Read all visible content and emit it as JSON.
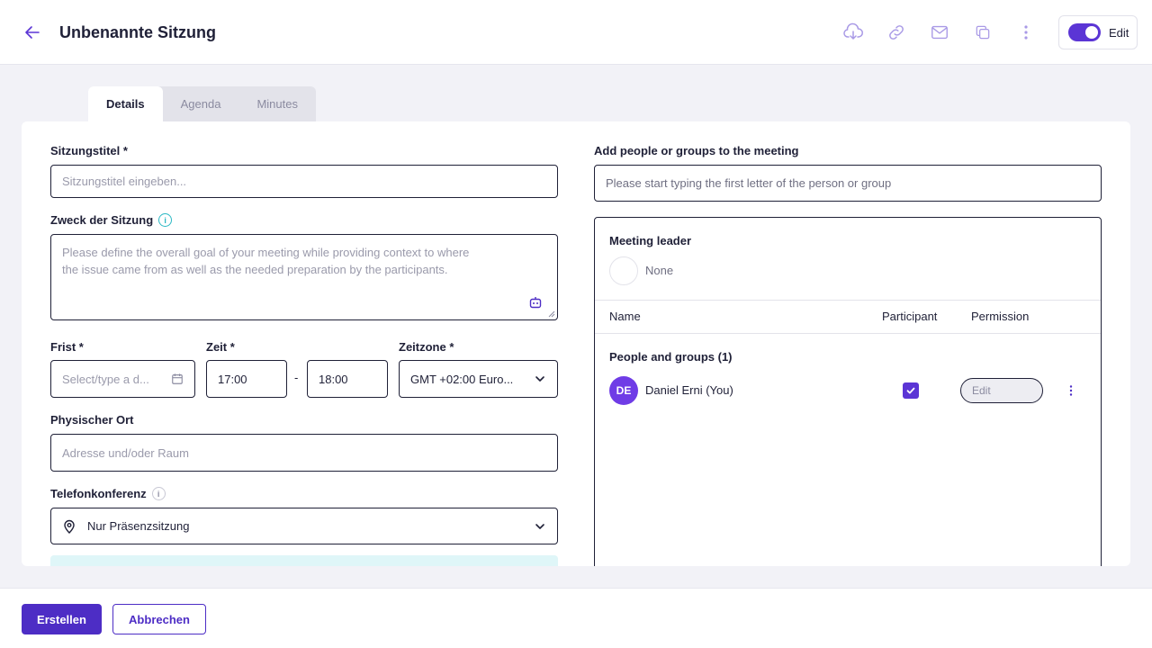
{
  "header": {
    "title": "Unbenannte Sitzung",
    "edit_label": "Edit",
    "edit_mode": true,
    "icons": [
      "arrow-left-icon",
      "cloud-download-icon",
      "link-icon",
      "mail-icon",
      "copy-icon",
      "more-vertical-icon"
    ]
  },
  "tabs": [
    {
      "label": "Details",
      "active": true
    },
    {
      "label": "Agenda",
      "active": false
    },
    {
      "label": "Minutes",
      "active": false
    }
  ],
  "form": {
    "title_label": "Sitzungstitel *",
    "title_placeholder": "Sitzungstitel eingeben...",
    "purpose_label": "Zweck der Sitzung",
    "purpose_placeholder_line1": "Please define the overall goal of your meeting while providing context to where",
    "purpose_placeholder_line2": "the issue came from as well as the needed preparation by the participants.",
    "deadline_label": "Frist *",
    "deadline_placeholder": "Select/type a d...",
    "time_label": "Zeit *",
    "time_start": "17:00",
    "time_separator": "-",
    "time_end": "18:00",
    "timezone_label": "Zeitzone *",
    "timezone_value": "GMT +02:00 Euro...",
    "location_label": "Physischer Ort",
    "location_placeholder": "Adresse und/oder Raum",
    "conference_label": "Telefonkonferenz",
    "conference_value": "Nur Präsenzsitzung"
  },
  "people": {
    "add_label": "Add people or groups to the meeting",
    "search_placeholder": "Please start typing the first letter of the person or group",
    "leader_label": "Meeting leader",
    "leader_value": "None",
    "col_name": "Name",
    "col_participant": "Participant",
    "col_permission": "Permission",
    "group_heading": "People and groups (1)",
    "members": [
      {
        "initials": "DE",
        "name": "Daniel Erni (You)",
        "participant": true,
        "permission": "Edit"
      }
    ]
  },
  "footer": {
    "create_label": "Erstellen",
    "cancel_label": "Abbrechen"
  },
  "colors": {
    "accent": "#5b35d5",
    "primary_button": "#4d2dc5",
    "avatar": "#6f3ce6",
    "icon_muted": "#a99ae6",
    "info_teal": "#2bb8c4",
    "text_dark": "#1f2037"
  }
}
